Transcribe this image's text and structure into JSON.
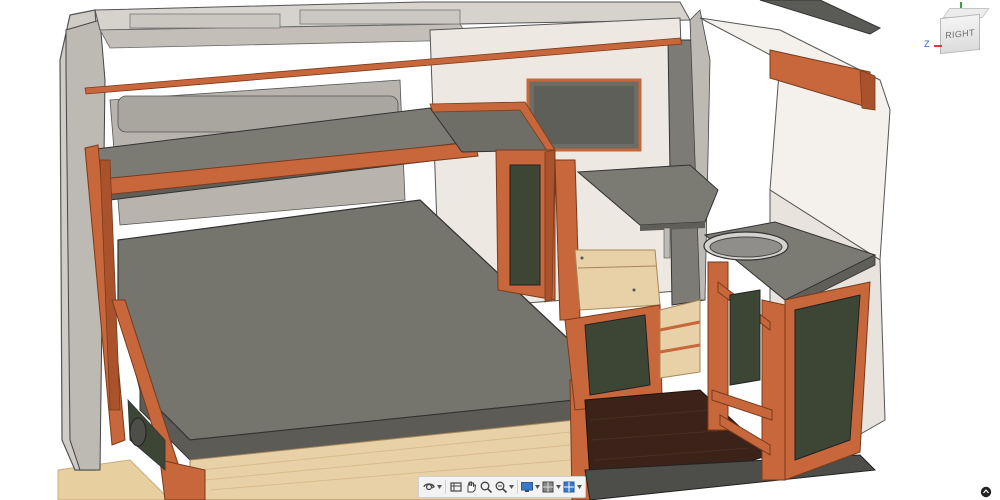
{
  "viewport": {
    "scene_description_icon": "camper-van-interior-3d-model"
  },
  "viewcube": {
    "face_label": "RIGHT",
    "axis_z_label": "Z"
  },
  "toolbar": {
    "buttons": [
      {
        "icon": "orbit-icon",
        "has_dropdown": true
      },
      {
        "icon": "look-at-icon",
        "has_dropdown": false
      },
      {
        "icon": "pan-icon",
        "has_dropdown": false
      },
      {
        "icon": "zoom-icon",
        "has_dropdown": false
      },
      {
        "icon": "fit-window-icon",
        "has_dropdown": true
      },
      {
        "icon": "display-settings-icon",
        "has_dropdown": true
      },
      {
        "icon": "grid-snaps-icon",
        "has_dropdown": true
      },
      {
        "icon": "viewports-icon",
        "has_dropdown": true
      }
    ]
  },
  "colors": {
    "wood": "#c7673b",
    "van_shell": "#d9d6d0",
    "cushion": "#707068",
    "floor": "#3b231a",
    "cabinet_panel": "#3d4534",
    "birch": "#e8d0a7"
  }
}
